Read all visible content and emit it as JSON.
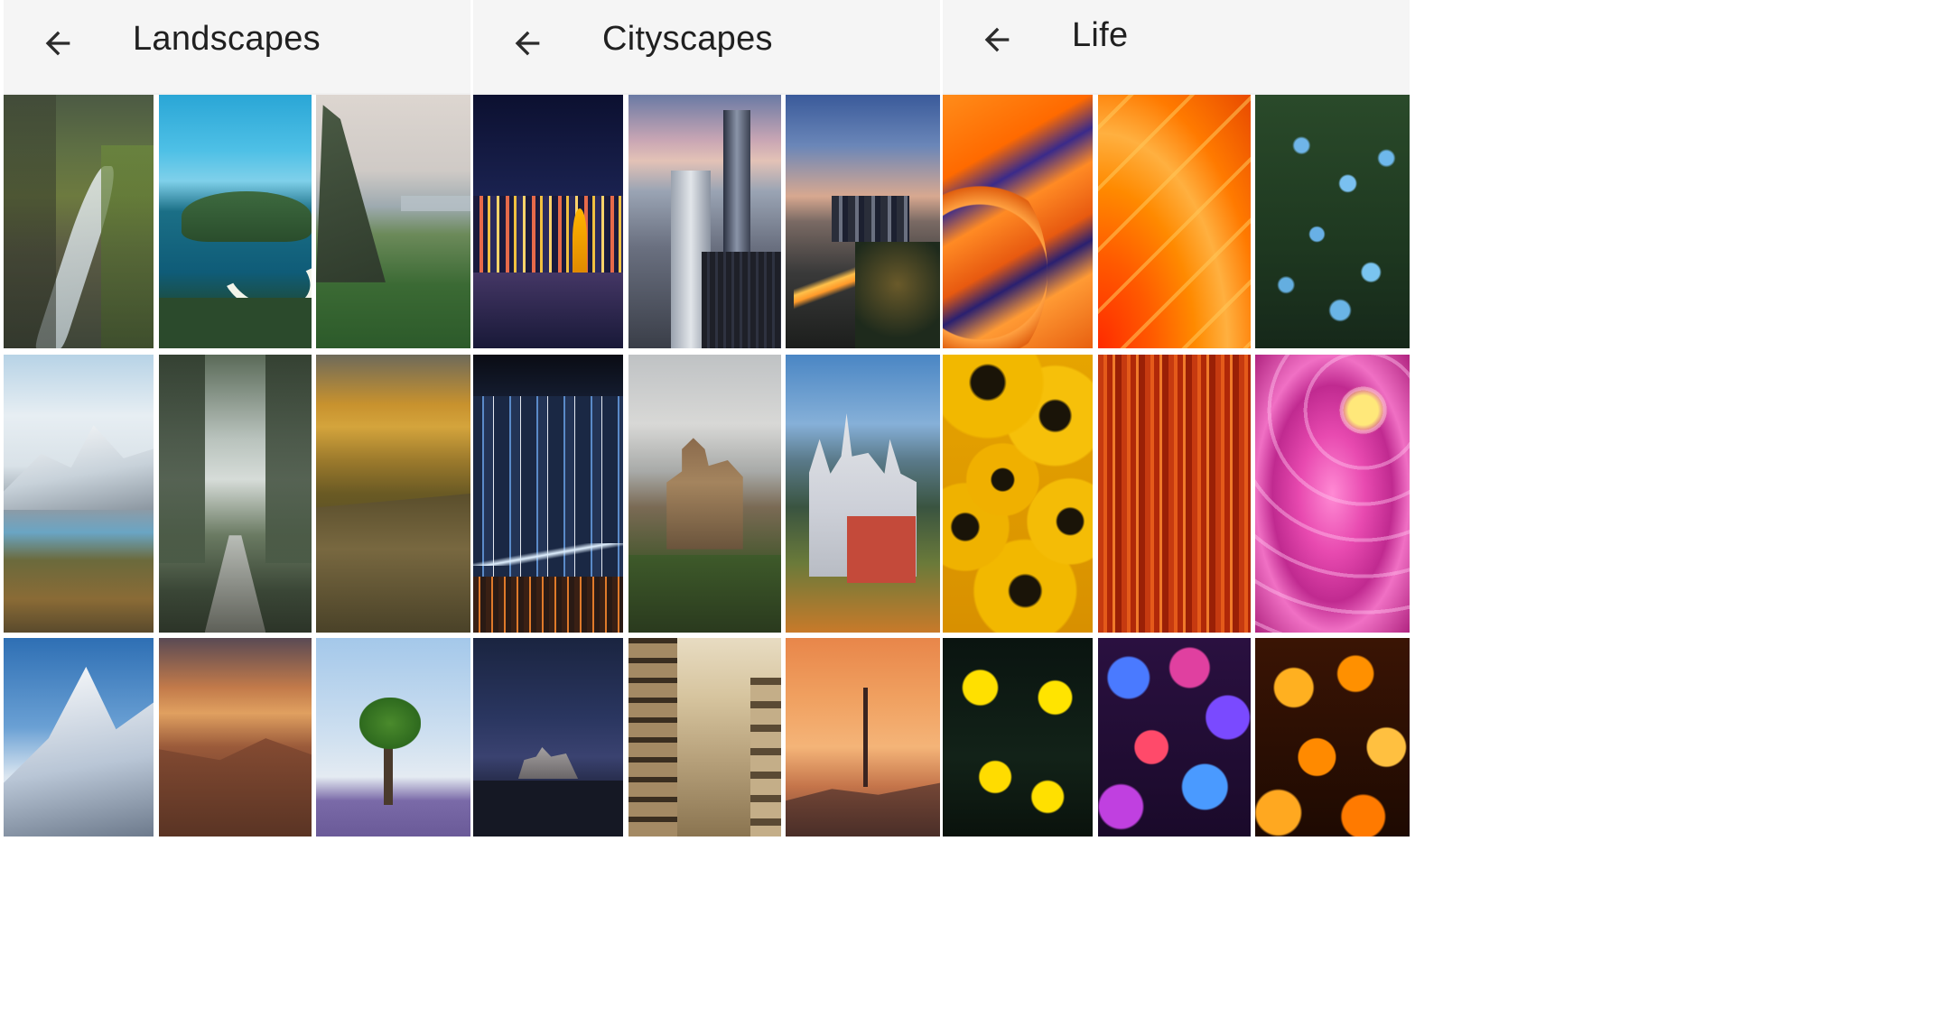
{
  "panels": [
    {
      "title": "Landscapes",
      "tiles": [
        "mountain-valley-river",
        "turquoise-bay-coast",
        "cliff-green-plains",
        "snowy-mountains-lake",
        "misty-forest-road",
        "golden-canyon-cliffs",
        "snow-peak",
        "desert-canyon-sunset",
        "lone-tree-lavender"
      ]
    },
    {
      "title": "Cityscapes",
      "tiles": [
        "night-skyline-waterfront",
        "skyscraper-sunset",
        "city-highway-dusk",
        "neon-city-night",
        "hilltop-castle",
        "fairytale-castle",
        "starry-night-town",
        "sepia-street",
        "orange-sunset-tower"
      ]
    },
    {
      "title": "Life",
      "tiles": [
        "orange-abstract-waves",
        "orange-petals-macro",
        "blue-forget-me-nots",
        "yellow-sunflowers",
        "red-orange-streaks",
        "pink-dahlia",
        "yellow-tulips-dark",
        "colorful-bokeh",
        "orange-bokeh"
      ]
    }
  ],
  "colors": {
    "header_bg": "#f5f5f5",
    "title_text": "#202020",
    "icon": "#2b2b2b"
  }
}
